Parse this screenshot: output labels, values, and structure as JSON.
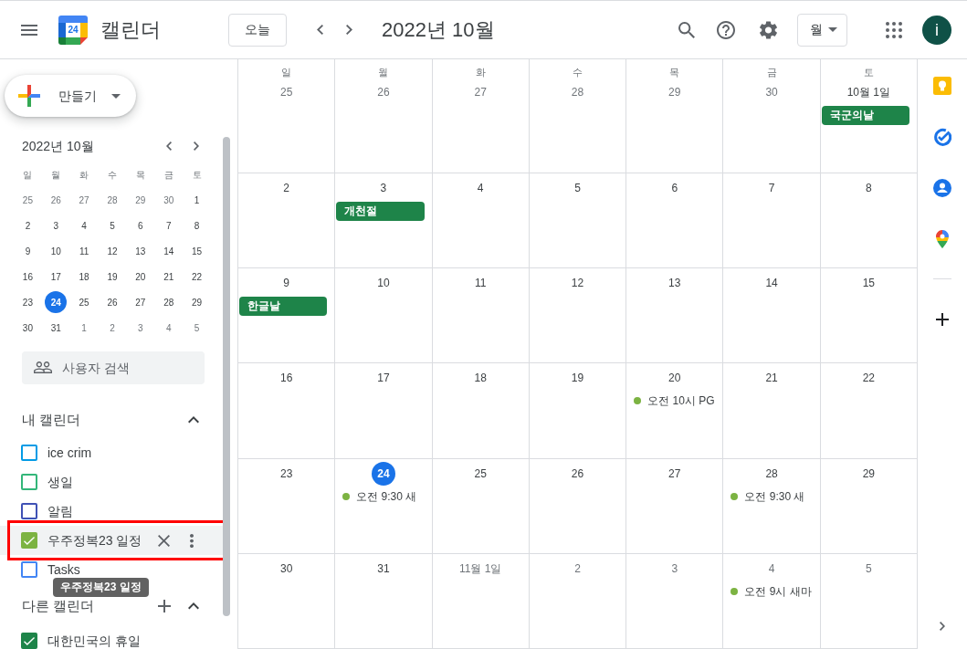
{
  "header": {
    "logo_text": "24",
    "app_name": "캘린더",
    "today_button": "오늘",
    "period_title": "2022년 10월",
    "view_button": "월",
    "avatar_initial": "i"
  },
  "sidebar": {
    "create_button": "만들기",
    "mini_calendar": {
      "title": "2022년 10월",
      "weekdays": [
        "일",
        "월",
        "화",
        "수",
        "목",
        "금",
        "토"
      ],
      "weeks": [
        [
          {
            "day": "25",
            "in_month": false,
            "selected": false
          },
          {
            "day": "26",
            "in_month": false,
            "selected": false
          },
          {
            "day": "27",
            "in_month": false,
            "selected": false
          },
          {
            "day": "28",
            "in_month": false,
            "selected": false
          },
          {
            "day": "29",
            "in_month": false,
            "selected": false
          },
          {
            "day": "30",
            "in_month": false,
            "selected": false
          },
          {
            "day": "1",
            "in_month": true,
            "selected": false
          }
        ],
        [
          {
            "day": "2",
            "in_month": true,
            "selected": false
          },
          {
            "day": "3",
            "in_month": true,
            "selected": false
          },
          {
            "day": "4",
            "in_month": true,
            "selected": false
          },
          {
            "day": "5",
            "in_month": true,
            "selected": false
          },
          {
            "day": "6",
            "in_month": true,
            "selected": false
          },
          {
            "day": "7",
            "in_month": true,
            "selected": false
          },
          {
            "day": "8",
            "in_month": true,
            "selected": false
          }
        ],
        [
          {
            "day": "9",
            "in_month": true,
            "selected": false
          },
          {
            "day": "10",
            "in_month": true,
            "selected": false
          },
          {
            "day": "11",
            "in_month": true,
            "selected": false
          },
          {
            "day": "12",
            "in_month": true,
            "selected": false
          },
          {
            "day": "13",
            "in_month": true,
            "selected": false
          },
          {
            "day": "14",
            "in_month": true,
            "selected": false
          },
          {
            "day": "15",
            "in_month": true,
            "selected": false
          }
        ],
        [
          {
            "day": "16",
            "in_month": true,
            "selected": false
          },
          {
            "day": "17",
            "in_month": true,
            "selected": false
          },
          {
            "day": "18",
            "in_month": true,
            "selected": false
          },
          {
            "day": "19",
            "in_month": true,
            "selected": false
          },
          {
            "day": "20",
            "in_month": true,
            "selected": false
          },
          {
            "day": "21",
            "in_month": true,
            "selected": false
          },
          {
            "day": "22",
            "in_month": true,
            "selected": false
          }
        ],
        [
          {
            "day": "23",
            "in_month": true,
            "selected": false
          },
          {
            "day": "24",
            "in_month": true,
            "selected": true
          },
          {
            "day": "25",
            "in_month": true,
            "selected": false
          },
          {
            "day": "26",
            "in_month": true,
            "selected": false
          },
          {
            "day": "27",
            "in_month": true,
            "selected": false
          },
          {
            "day": "28",
            "in_month": true,
            "selected": false
          },
          {
            "day": "29",
            "in_month": true,
            "selected": false
          }
        ],
        [
          {
            "day": "30",
            "in_month": true,
            "selected": false
          },
          {
            "day": "31",
            "in_month": true,
            "selected": false
          },
          {
            "day": "1",
            "in_month": false,
            "selected": false
          },
          {
            "day": "2",
            "in_month": false,
            "selected": false
          },
          {
            "day": "3",
            "in_month": false,
            "selected": false
          },
          {
            "day": "4",
            "in_month": false,
            "selected": false
          },
          {
            "day": "5",
            "in_month": false,
            "selected": false
          }
        ]
      ]
    },
    "people_search": {
      "placeholder": "사용자 검색"
    },
    "my_calendars": {
      "title": "내 캘린더",
      "expanded": true,
      "items": [
        {
          "name": "ice crim",
          "color": "#039be5",
          "checked": false,
          "hovered": false,
          "highlighted": false
        },
        {
          "name": "생일",
          "color": "#33b679",
          "checked": false,
          "hovered": false,
          "highlighted": false
        },
        {
          "name": "알림",
          "color": "#3f51b5",
          "checked": false,
          "hovered": false,
          "highlighted": false
        },
        {
          "name": "우주정복23 일정",
          "color": "#7cb342",
          "checked": true,
          "hovered": true,
          "highlighted": true
        },
        {
          "name": "Tasks",
          "color": "#4285f4",
          "checked": false,
          "hovered": false,
          "highlighted": false
        }
      ]
    },
    "tooltip": {
      "text": "우주정복23 일정"
    },
    "other_calendars": {
      "title": "다른 캘린더",
      "expanded": true,
      "items": [
        {
          "name": "대한민국의 휴일",
          "color": "#1e8449",
          "checked": true,
          "hovered": false,
          "highlighted": false
        }
      ]
    }
  },
  "month_grid": {
    "weekdays": [
      "일",
      "월",
      "화",
      "수",
      "목",
      "금",
      "토"
    ],
    "weeks": [
      [
        {
          "date": "25",
          "in_month": false,
          "today": false
        },
        {
          "date": "26",
          "in_month": false,
          "today": false
        },
        {
          "date": "27",
          "in_month": false,
          "today": false
        },
        {
          "date": "28",
          "in_month": false,
          "today": false
        },
        {
          "date": "29",
          "in_month": false,
          "today": false
        },
        {
          "date": "30",
          "in_month": false,
          "today": false
        },
        {
          "date": "10월 1일",
          "in_month": true,
          "today": false,
          "events": [
            {
              "kind": "allday",
              "title": "국군의날"
            }
          ]
        }
      ],
      [
        {
          "date": "2",
          "in_month": true,
          "today": false
        },
        {
          "date": "3",
          "in_month": true,
          "today": false,
          "events": [
            {
              "kind": "allday",
              "title": "개천절"
            }
          ]
        },
        {
          "date": "4",
          "in_month": true,
          "today": false
        },
        {
          "date": "5",
          "in_month": true,
          "today": false
        },
        {
          "date": "6",
          "in_month": true,
          "today": false
        },
        {
          "date": "7",
          "in_month": true,
          "today": false
        },
        {
          "date": "8",
          "in_month": true,
          "today": false
        }
      ],
      [
        {
          "date": "9",
          "in_month": true,
          "today": false,
          "events": [
            {
              "kind": "allday",
              "title": "한글날"
            }
          ]
        },
        {
          "date": "10",
          "in_month": true,
          "today": false
        },
        {
          "date": "11",
          "in_month": true,
          "today": false
        },
        {
          "date": "12",
          "in_month": true,
          "today": false
        },
        {
          "date": "13",
          "in_month": true,
          "today": false
        },
        {
          "date": "14",
          "in_month": true,
          "today": false
        },
        {
          "date": "15",
          "in_month": true,
          "today": false
        }
      ],
      [
        {
          "date": "16",
          "in_month": true,
          "today": false
        },
        {
          "date": "17",
          "in_month": true,
          "today": false
        },
        {
          "date": "18",
          "in_month": true,
          "today": false
        },
        {
          "date": "19",
          "in_month": true,
          "today": false
        },
        {
          "date": "20",
          "in_month": true,
          "today": false,
          "events": [
            {
              "kind": "timed",
              "title": "오전 10시 PG"
            }
          ]
        },
        {
          "date": "21",
          "in_month": true,
          "today": false
        },
        {
          "date": "22",
          "in_month": true,
          "today": false
        }
      ],
      [
        {
          "date": "23",
          "in_month": true,
          "today": false
        },
        {
          "date": "24",
          "in_month": true,
          "today": true,
          "events": [
            {
              "kind": "timed",
              "title": "오전 9:30 새"
            }
          ]
        },
        {
          "date": "25",
          "in_month": true,
          "today": false
        },
        {
          "date": "26",
          "in_month": true,
          "today": false
        },
        {
          "date": "27",
          "in_month": true,
          "today": false
        },
        {
          "date": "28",
          "in_month": true,
          "today": false,
          "events": [
            {
              "kind": "timed",
              "title": "오전 9:30 새"
            }
          ]
        },
        {
          "date": "29",
          "in_month": true,
          "today": false
        }
      ],
      [
        {
          "date": "30",
          "in_month": true,
          "today": false
        },
        {
          "date": "31",
          "in_month": true,
          "today": false
        },
        {
          "date": "11월 1일",
          "in_month": false,
          "today": false
        },
        {
          "date": "2",
          "in_month": false,
          "today": false
        },
        {
          "date": "3",
          "in_month": false,
          "today": false
        },
        {
          "date": "4",
          "in_month": false,
          "today": false,
          "events": [
            {
              "kind": "timed",
              "title": "오전 9시 새마"
            }
          ]
        },
        {
          "date": "5",
          "in_month": false,
          "today": false
        }
      ]
    ]
  }
}
